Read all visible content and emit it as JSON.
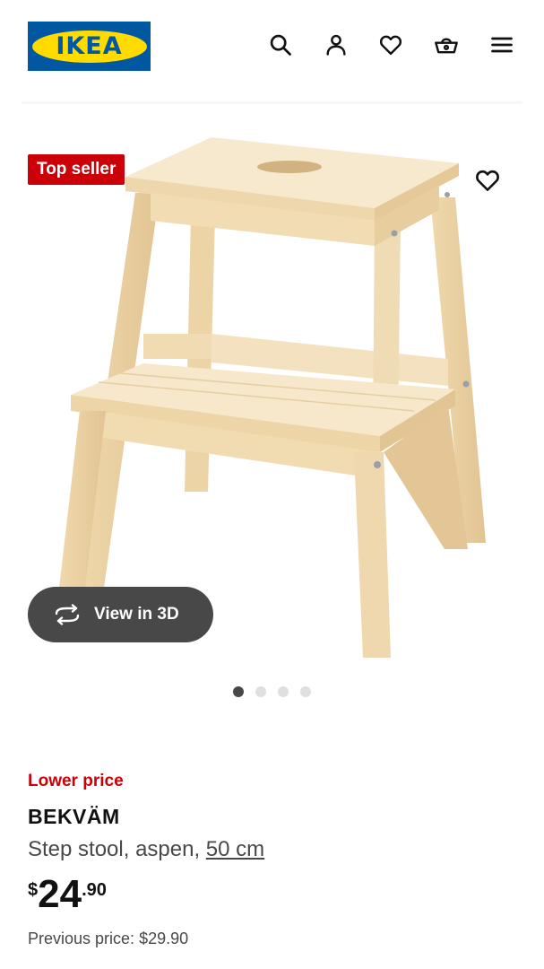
{
  "header": {
    "logo_text": "IKEA",
    "icons": [
      "search-icon",
      "account-icon",
      "wishlist-icon",
      "cart-icon",
      "menu-icon"
    ]
  },
  "product_image": {
    "badge": "Top seller",
    "view_3d_label": "View in 3D",
    "carousel": {
      "total": 4,
      "active": 1
    }
  },
  "product": {
    "promo_label": "Lower price",
    "name": "BEKVÄM",
    "description": "Step stool, aspen, ",
    "size": "50 cm",
    "price": {
      "currency": "$",
      "integer": "24",
      "decimal": ".90"
    },
    "previous_price_label": "Previous price: ",
    "previous_price": "$29.90"
  },
  "colors": {
    "brand_blue": "#0058a3",
    "brand_yellow": "#ffdb00",
    "accent_red": "#cc0008",
    "button_dark": "#484848"
  }
}
